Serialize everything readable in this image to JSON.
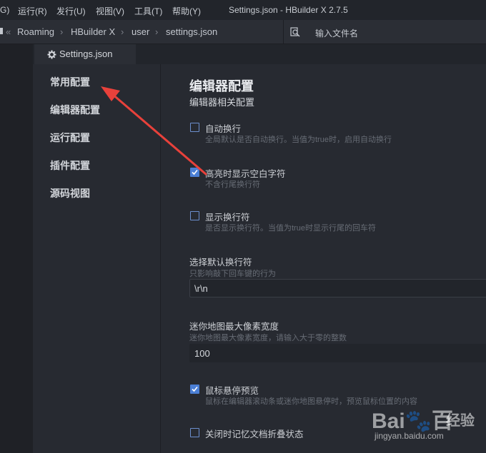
{
  "menubar": {
    "items": [
      "G)",
      "运行(R)",
      "发行(U)",
      "视图(V)",
      "工具(T)",
      "帮助(Y)"
    ],
    "title": "Settings.json - HBuilder X 2.7.5"
  },
  "breadcrumb": {
    "parts": [
      "Roaming",
      "HBuilder X",
      "user",
      "settings.json"
    ],
    "search_placeholder": "输入文件名"
  },
  "tab": {
    "label": "Settings.json"
  },
  "sidebar": {
    "items": [
      "常用配置",
      "编辑器配置",
      "运行配置",
      "插件配置",
      "源码视图"
    ]
  },
  "section": {
    "title": "编辑器配置",
    "subtitle": "编辑器相关配置"
  },
  "options": [
    {
      "label": "自动换行",
      "desc": "全局默认是否自动换行。当值为true时，启用自动换行",
      "checked": false
    },
    {
      "label": "高亮时显示空白字符",
      "desc": "不含行尾换行符",
      "checked": true
    },
    {
      "label": "显示换行符",
      "desc": "是否显示换行符。当值为true时显示行尾的回车符",
      "checked": false
    }
  ],
  "fields": [
    {
      "label": "选择默认换行符",
      "desc": "只影响敲下回车键的行为",
      "value": "\\r\\n"
    },
    {
      "label": "迷你地图最大像素宽度",
      "desc": "迷你地图最大像素宽度，请输入大于零的整数",
      "value": "100"
    }
  ],
  "options2": [
    {
      "label": "鼠标悬停预览",
      "desc": "鼠标在编辑器滚动条或迷你地图悬停时，预览鼠标位置的内容",
      "checked": true
    },
    {
      "label": "关闭时记忆文档折叠状态",
      "desc": "",
      "checked": false
    }
  ],
  "watermark": {
    "logo": "Bai🐾百",
    "cn": "经验",
    "url": "jingyan.baidu.com"
  },
  "colors": {
    "background": "#272a31",
    "accent": "#4b7fd5",
    "arrow": "#e8413b"
  }
}
